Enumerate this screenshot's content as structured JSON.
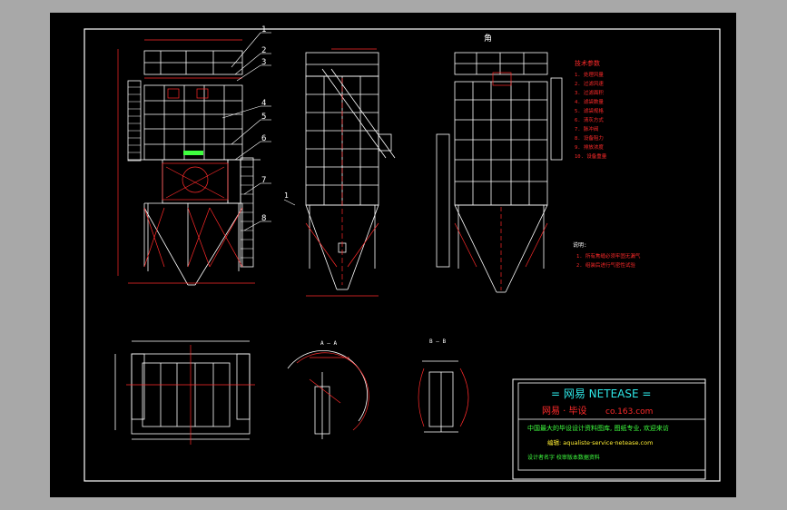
{
  "part_numbers": [
    "1",
    "2",
    "3",
    "4",
    "5",
    "6",
    "7",
    "8"
  ],
  "view_labels": {
    "side_top": "角",
    "section_a": "A — A",
    "section_b": "B — B",
    "arrow_a": "A",
    "arrow_1": "1"
  },
  "tech_params": {
    "heading": "技术参数",
    "rows": [
      "1. 处理风量",
      "2. 过滤风速",
      "3. 过滤面积",
      "4. 滤袋数量",
      "5. 滤袋规格",
      "6. 清灰方式",
      "7. 脉冲阀",
      "8. 设备阻力",
      "9. 排放浓度",
      "10. 设备重量"
    ]
  },
  "notes": {
    "heading": "说明:",
    "lines": [
      "1. 所有焦缝必须牢固无漏气",
      "2. 组装后进行气密性试验"
    ]
  },
  "title_block": {
    "line1": "= 网易  NETEASE =",
    "line2_cn": "网易 · 毕设",
    "line2_url": "co.163.com",
    "line3": "中国最大的毕设设计资料图库, 图纸专业, 欢迎来访",
    "line4": "编辑: aqualiste·service·netease.com",
    "line5": "设计者名字 校审版本数据资料"
  },
  "colors": {
    "sheet": "#000000",
    "frame": "#ffffff",
    "red": "#ff2a2a",
    "cyan": "#2ee8e8",
    "green": "#3fff3f",
    "yellow": "#ffee33"
  }
}
